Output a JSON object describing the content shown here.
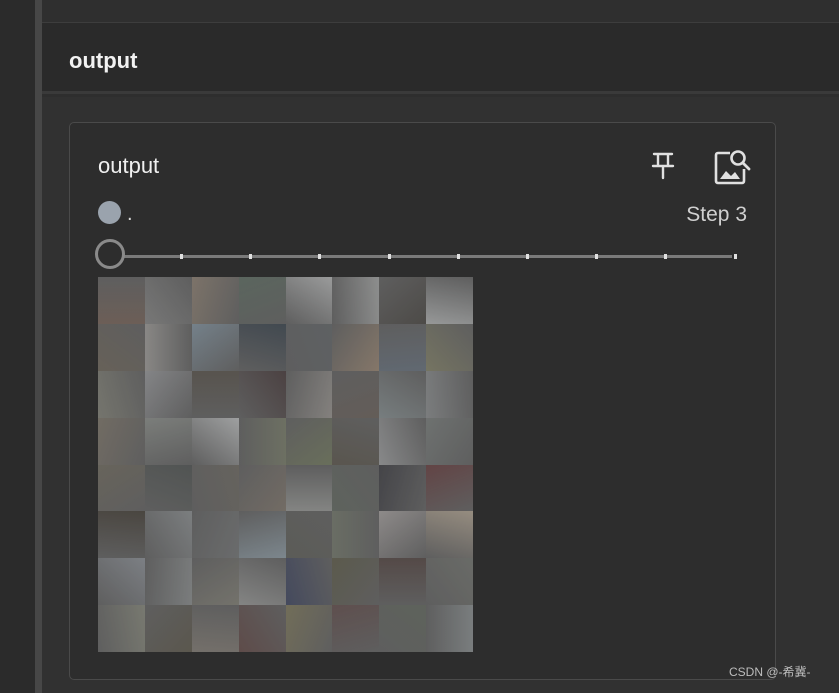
{
  "section": {
    "title": "output"
  },
  "card": {
    "title": "output",
    "run_label": ".",
    "step_label": "Step 3",
    "icons": [
      "pin-icon",
      "image-search-icon"
    ],
    "run_color": "#9aa3ad"
  },
  "slider": {
    "ticks": 9,
    "value_index": 0
  },
  "grid": {
    "rows": 8,
    "cols": 8,
    "cell_colors": [
      [
        "#8a6d5c",
        "#8d8d8c",
        "#9a8671",
        "#637a6a",
        "#b4b6b6",
        "#a5a7a6",
        "#5c5750",
        "#b0b3b3"
      ],
      [
        "#7e715f",
        "#a29f9a",
        "#7f99ad",
        "#475766",
        "#6d7277",
        "#a88a6c",
        "#6c7c8f",
        "#8c8a62"
      ],
      [
        "#8a8a7a",
        "#9a9ca0",
        "#6b6256",
        "#604b4c",
        "#9d9791",
        "#7b6c62",
        "#879598",
        "#8f9395"
      ],
      [
        "#8a7e6c",
        "#8f948e",
        "#b9bcbd",
        "#7f8568",
        "#79855a",
        "#6d6455",
        "#9fa1a3",
        "#7f8683"
      ],
      [
        "#7d7563",
        "#5d6461",
        "#7a7468",
        "#8c7e6e",
        "#9a9c98",
        "#6c7669",
        "#505058",
        "#8a4a4c"
      ],
      [
        "#5a5246",
        "#8f9598",
        "#7c7f80",
        "#8aa0ae",
        "#6b6d62",
        "#7a826e",
        "#a9a2a0",
        "#b8a489"
      ],
      [
        "#8f96a0",
        "#8e9394",
        "#8a8778",
        "#9b9c9a",
        "#4b5680",
        "#6e6a4e",
        "#6b5550",
        "#7b7e76"
      ],
      [
        "#8d8f7c",
        "#6e6652",
        "#8c8377",
        "#7d5551",
        "#8a8155",
        "#7b5a58",
        "#6c7566",
        "#8c9496"
      ]
    ]
  }
}
